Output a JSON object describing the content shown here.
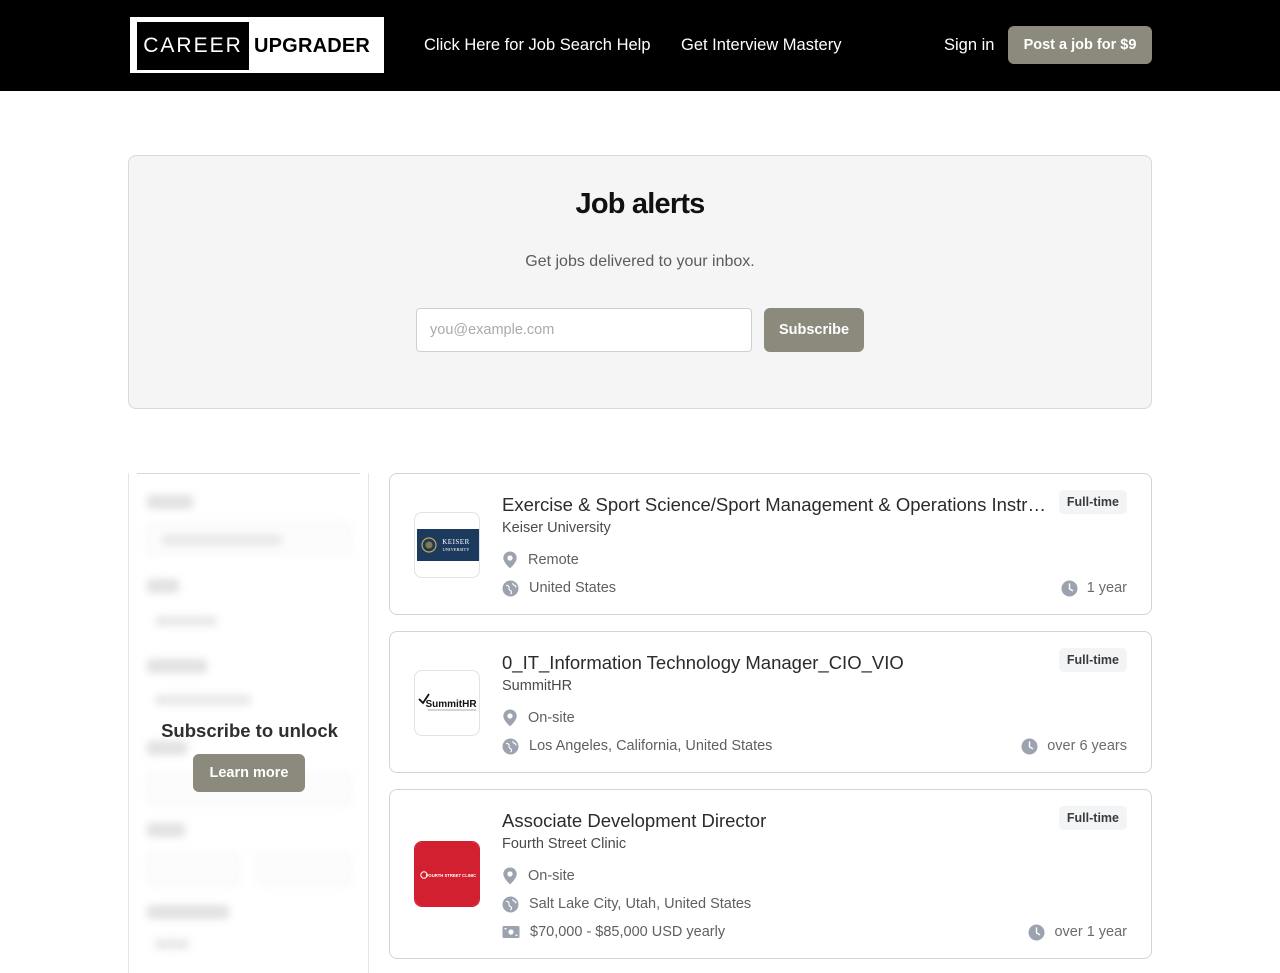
{
  "header": {
    "logo_left": "CAREER",
    "logo_right": "UPGRADER",
    "nav": [
      "Click Here for Job Search Help",
      "Get Interview Mastery"
    ],
    "sign_in": "Sign in",
    "post_job": "Post a job for $9"
  },
  "alerts": {
    "title": "Job alerts",
    "subtitle": "Get jobs delivered to your inbox.",
    "email_placeholder": "you@example.com",
    "subscribe": "Subscribe"
  },
  "filters": {
    "unlock_text": "Subscribe to unlock",
    "learn_more": "Learn more"
  },
  "jobs": [
    {
      "title": "Exercise & Sport Science/Sport Management & Operations Instructor",
      "company": "Keiser University",
      "type": "Full-time",
      "workplace": "Remote",
      "location": "United States",
      "age": "1 year",
      "logo_text": "KEISER UNIVERSITY",
      "logo_color": "#1c3a5e"
    },
    {
      "title": "0_IT_Information Technology Manager_CIO_VIO",
      "company": "SummitHR",
      "type": "Full-time",
      "workplace": "On-site",
      "location": "Los Angeles, California, United States",
      "age": "over 6 years",
      "logo_text": "SummitHR"
    },
    {
      "title": "Associate Development Director",
      "company": "Fourth Street Clinic",
      "type": "Full-time",
      "workplace": "On-site",
      "location": "Salt Lake City, Utah, United States",
      "salary": "$70,000 - $85,000 USD yearly",
      "age": "over 1 year",
      "logo_text": "FOURTH STREET CLINIC",
      "logo_color": "#d32030"
    }
  ],
  "colors": {
    "header_bg": "#000000",
    "accent_button": "#8b8a7c"
  }
}
